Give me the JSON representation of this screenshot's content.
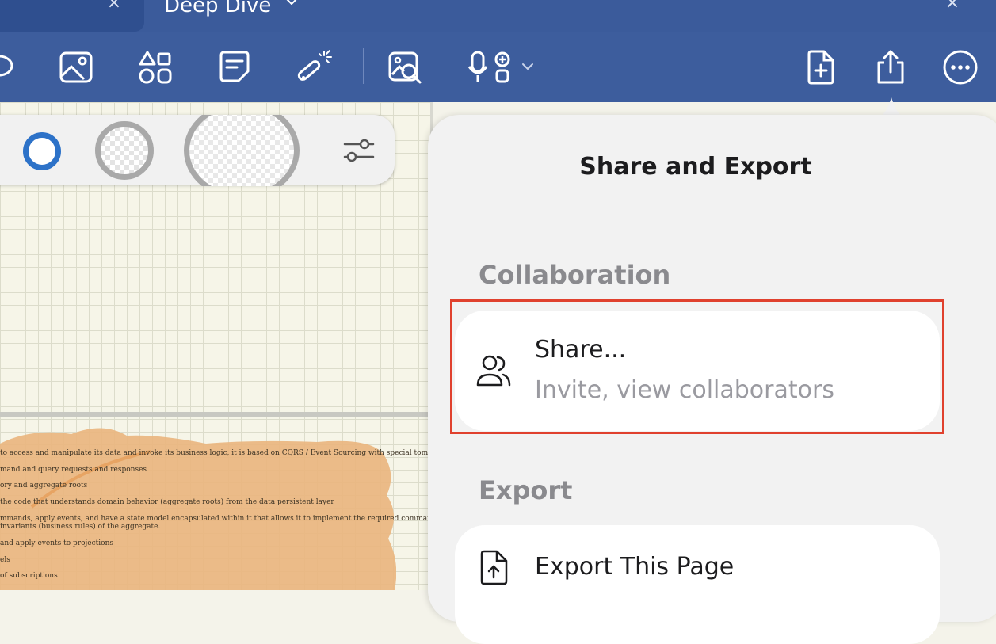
{
  "tabs": {
    "active_label": "Deep Dive"
  },
  "toolbar": {
    "icons": [
      "lasso-icon",
      "image-icon",
      "shapes-icon",
      "sticky-note-icon",
      "laser-pointer-icon",
      "image-search-icon",
      "microphone-add-icon",
      "new-page-icon",
      "share-icon",
      "more-icon"
    ]
  },
  "pen_bar": {
    "selected_color": "#2d72c8"
  },
  "note": {
    "lines": [
      "to access and manipulate its data and invoke its business logic, it is based on CQRS / Event Sourcing with special tombstone handling",
      "mand and query requests and responses",
      "ory and aggregate roots",
      "the code that understands domain behavior (aggregate roots) from the data persistent layer",
      "mmands, apply events, and have a state model encapsulated within it that allows it to implement the required command validation, thus",
      "invariants (business rules) of the aggregate.",
      "and apply events to projections",
      "els",
      "of subscriptions"
    ]
  },
  "popover": {
    "title": "Share and Export",
    "collaboration": {
      "heading": "Collaboration",
      "share": {
        "title": "Share...",
        "subtitle": "Invite, view collaborators"
      }
    },
    "export": {
      "heading": "Export",
      "export_page": {
        "title": "Export This Page"
      }
    }
  },
  "colors": {
    "toolbar": "#3d5d9d",
    "highlight": "#e0412e"
  }
}
